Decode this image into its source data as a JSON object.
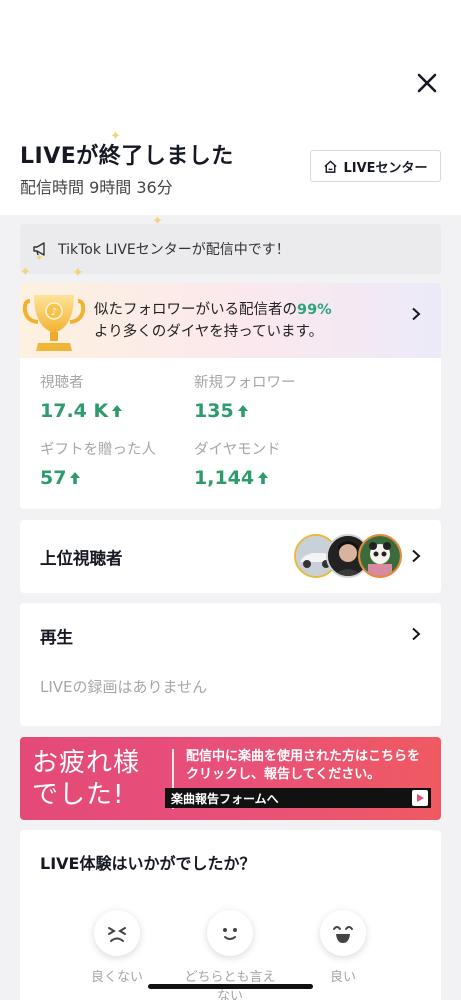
{
  "header": {
    "title": "LIVEが終了しました",
    "duration": "配信時間 9時間 36分",
    "center_button": "LIVEセンター"
  },
  "notice": {
    "text": "TikTok LIVEセンターが配信中です！"
  },
  "promo": {
    "line1_prefix": "似たフォロワーがいる配信者の",
    "percent": "99%",
    "line2": "より多くのダイヤを持っています。"
  },
  "stats": [
    {
      "label": "視聴者",
      "value": "17.4 K"
    },
    {
      "label": "新規フォロワー",
      "value": "135"
    },
    {
      "label": "ギフトを贈った人",
      "value": "57"
    },
    {
      "label": "ダイヤモンド",
      "value": "1,144"
    }
  ],
  "top_viewers": {
    "title": "上位視聴者"
  },
  "replay": {
    "title": "再生",
    "empty": "LIVEの録画はありません"
  },
  "banner": {
    "big_line1": "お疲れ様",
    "big_line2": "でした!",
    "msg_line1": "配信中に楽曲を使用された方はこちらを",
    "msg_line2": "クリックし、報告してください。",
    "link": "楽曲報告フォームへ"
  },
  "feedback": {
    "title": "LIVE体験はいかがでしたか？",
    "options": [
      "良くない",
      "どちらとも言えない",
      "良い"
    ]
  },
  "colors": {
    "accent_green": "#2e9b6c",
    "banner_pink": "#e8507a"
  }
}
